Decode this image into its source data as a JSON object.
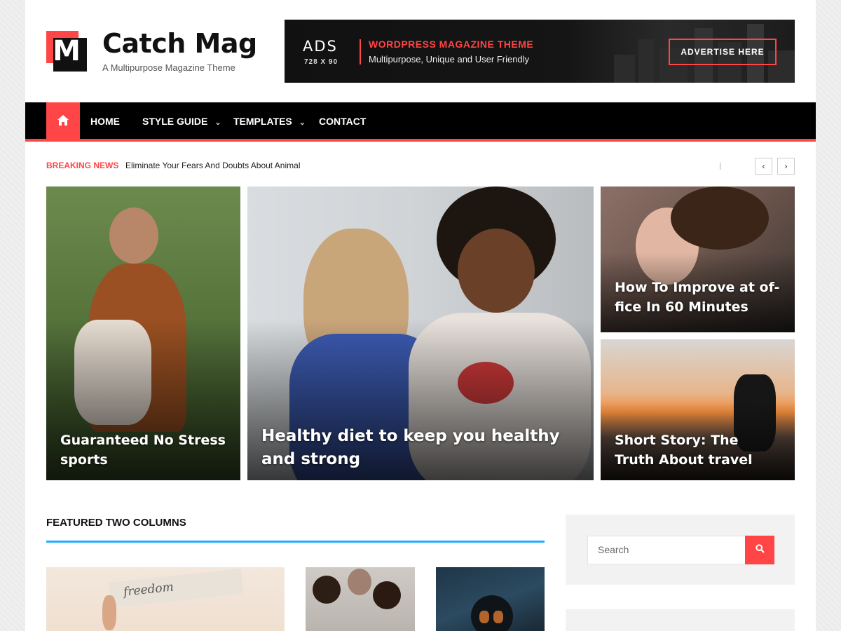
{
  "site": {
    "logo_letter": "M",
    "title": "Catch Mag",
    "tagline": "A Multipurpose Magazine Theme"
  },
  "ad": {
    "label": "ADS",
    "size": "728 X 90",
    "headline": "WORDPRESS MAGAZINE THEME",
    "subline": "Multipurpose, Unique and User Friendly",
    "button": "ADVERTISE HERE"
  },
  "nav": {
    "home_icon": "home-icon",
    "items": [
      {
        "label": "HOME",
        "dropdown": false
      },
      {
        "label": "STYLE GUIDE",
        "dropdown": true
      },
      {
        "label": "TEMPLATES",
        "dropdown": true
      },
      {
        "label": "CONTACT",
        "dropdown": false
      }
    ]
  },
  "breaking": {
    "label": "BREAKING NEWS",
    "headline": "Eliminate Your Fears And Doubts About Animal",
    "prev": "‹",
    "next": "›"
  },
  "hero": {
    "left_title": "Guaranteed No Stress sports",
    "center_title": "Healthy diet to keep you healthy and strong",
    "right_top_title": "How To Improve at of-fice In 60 Minutes",
    "right_bottom_title": "Short Story: The Truth About travel"
  },
  "featured": {
    "title": "FEATURED TWO COLUMNS",
    "freedom_text": "freedom"
  },
  "sidebar": {
    "search_placeholder": "Search"
  },
  "colors": {
    "accent": "#ff4545",
    "nav_bg": "#000000",
    "featured_line": "#1faeff"
  }
}
